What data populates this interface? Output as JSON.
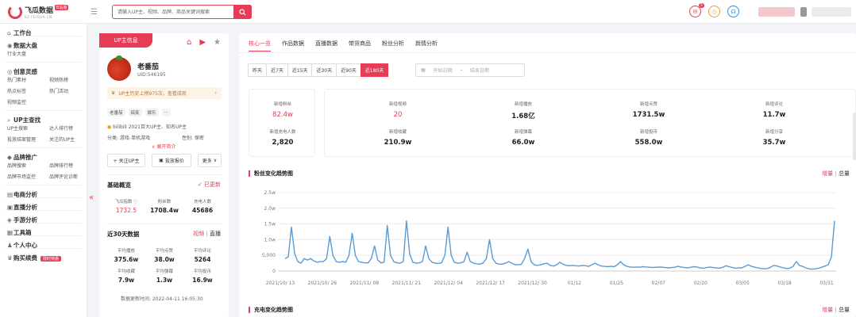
{
  "header": {
    "logo_name": "飞瓜数据",
    "logo_badge": "B站版",
    "logo_sub": "BZ.FEIGUA.CN",
    "search_placeholder": "请输入UP主、视频、品牌、商品关键词搜索",
    "message_count": "5",
    "icons": [
      "search-icon",
      "message-icon",
      "clock-icon",
      "headset-icon",
      "menu-icon"
    ]
  },
  "sidebar": {
    "groups": [
      {
        "icon": "home-icon",
        "title": "工作台",
        "items": []
      },
      {
        "icon": "chart-icon",
        "title": "数据大盘",
        "items": [
          "行业大盘"
        ]
      },
      {
        "icon": "bulb-icon",
        "title": "创意灵感",
        "items": [
          "热门素材",
          "视频热榜",
          "热点标签",
          "热门活动",
          "视频监控"
        ]
      },
      {
        "icon": "search-icon",
        "title": "UP主查找",
        "items": [
          "UP主搜索",
          "达人排行榜",
          "投放结案管理",
          "关注的UP主"
        ]
      },
      {
        "icon": "diamond-icon",
        "title": "品牌推广",
        "items": [
          "品牌搜索",
          "品牌排行榜",
          "品牌市场监控",
          "品牌评论诊断"
        ]
      },
      {
        "icon": "cart-icon",
        "title": "电商分析",
        "items": []
      },
      {
        "icon": "live-icon",
        "title": "直播分析",
        "items": []
      },
      {
        "icon": "game-icon",
        "title": "手游分析",
        "items": []
      },
      {
        "icon": "tools-icon",
        "title": "工具箱",
        "items": []
      },
      {
        "icon": "user-icon",
        "title": "个人中心",
        "items": []
      },
      {
        "icon": "vip-icon",
        "title": "购买续费",
        "items": [],
        "promo": "限时特惠"
      }
    ]
  },
  "profile": {
    "tab_label": "UP主信息",
    "name": "老番茄",
    "uid": "UID:546195",
    "honor": "UP主历史上榜975次，查看成就",
    "tags": [
      "老番茄",
      "搞笑",
      "娱乐",
      "..."
    ],
    "award": "bilibili 2021百大UP主、知名UP主",
    "category": "分类: 游戏-单机游戏",
    "gender": "性别: 保密",
    "expand_label": "展开简介",
    "buttons": {
      "follow": "+ 关注UP主",
      "quote": "投放报价",
      "more": "更多"
    },
    "basic": {
      "title": "基础概览",
      "update_label": "已更新",
      "metrics": [
        {
          "label": "飞瓜指数",
          "value": "1732.5"
        },
        {
          "label": "粉丝数",
          "value": "1708.4w"
        },
        {
          "label": "充电人数",
          "value": "45686"
        }
      ]
    },
    "recent": {
      "title": "近30天数据",
      "toggle_a": "视频",
      "toggle_sep": "|",
      "toggle_b": "直播",
      "metrics": [
        {
          "label": "平均播放",
          "value": "375.6w"
        },
        {
          "label": "平均点赞",
          "value": "38.0w"
        },
        {
          "label": "平均评论",
          "value": "5264"
        },
        {
          "label": "平均收藏",
          "value": "7.9w"
        },
        {
          "label": "平均弹幕",
          "value": "1.3w"
        },
        {
          "label": "平均投币",
          "value": "16.9w"
        }
      ],
      "updated": "数据更新时间:  2022-04-11 16:05:30"
    }
  },
  "main": {
    "tabs": [
      "核心一览",
      "作品数据",
      "直播数据",
      "带货商品",
      "粉丝分析",
      "舆情分析"
    ],
    "active_tab": 0,
    "ranges": [
      "昨天",
      "近7天",
      "近15天",
      "近30天",
      "近90天",
      "近180天"
    ],
    "active_range": 5,
    "date_start": "开始日期",
    "date_sep": "-",
    "date_end": "结束日期",
    "kpi_left": [
      {
        "label": "新增粉丝",
        "value": "82.4w",
        "accent": true
      },
      {
        "label": "新增充电人数",
        "value": "2,820"
      }
    ],
    "kpi_right": [
      {
        "label": "新增视频",
        "value": "20",
        "accent": true
      },
      {
        "label": "新增播放",
        "value": "1.68亿"
      },
      {
        "label": "新增点赞",
        "value": "1731.5w"
      },
      {
        "label": "新增评论",
        "value": "11.7w"
      },
      {
        "label": "新增收藏",
        "value": "210.9w"
      },
      {
        "label": "新增弹幕",
        "value": "66.0w"
      },
      {
        "label": "新增投币",
        "value": "558.0w"
      },
      {
        "label": "新增分享",
        "value": "35.7w"
      }
    ],
    "chart1_title": "粉丝变化趋势图",
    "chart2_title": "充电变化趋势图",
    "toggle_inc": "增量",
    "toggle_sep": "|",
    "toggle_total": "总量"
  },
  "chart_data": {
    "type": "line",
    "title": "粉丝变化趋势图",
    "yticks": [
      "0",
      "5,000",
      "1.0w",
      "1.5w",
      "2.0w",
      "2.5w"
    ],
    "ylim": [
      0,
      25000
    ],
    "xticks": [
      "2021/10/ 13",
      "2021/10/ 26",
      "2021/11/ 08",
      "2021/11/ 21",
      "2021/12/ 04",
      "2021/12/ 17",
      "2021/12/ 30",
      "01/12",
      "01/25",
      "02/07",
      "02/20",
      "03/05",
      "03/18",
      "03/31"
    ],
    "color": "#5b9bd5",
    "grid": true,
    "series": [
      {
        "values": [
          4000,
          4500,
          14000,
          5500,
          3000,
          2500,
          4000,
          3500,
          4000,
          3200,
          2800,
          3000,
          3000,
          4000,
          11000,
          5000,
          3000,
          2800,
          3000,
          2800,
          5000,
          12000,
          5000,
          3000,
          2800,
          2600,
          2600,
          4000,
          8000,
          3500,
          2600,
          2800,
          14500,
          5000,
          3000,
          2600,
          2500,
          3000,
          16000,
          5500,
          2800,
          2500,
          2600,
          3000,
          8000,
          4000,
          2800,
          2500,
          2400,
          2600,
          5000,
          14000,
          5000,
          2800,
          2500,
          2600,
          3000,
          6000,
          3000,
          2500,
          2300,
          2200,
          2500,
          4000,
          10000,
          4000,
          2500,
          2200,
          2200,
          2500,
          3000,
          2500,
          2000,
          2000,
          2200,
          4000,
          7000,
          3000,
          2000,
          1800,
          2000,
          2300,
          2500,
          1800,
          1600,
          2000,
          2800,
          2200,
          1800,
          1700,
          1800,
          1700,
          1600,
          1800,
          1700,
          1500,
          2000,
          2500,
          2000,
          1600,
          1500,
          1400,
          1500,
          1400,
          2000,
          3000,
          2000,
          1500,
          1300,
          1200,
          1300,
          1200,
          1400,
          1300,
          1200,
          1100,
          1200,
          1300,
          1200,
          1100,
          1000,
          1100,
          1200,
          1500,
          1300,
          1100,
          1000,
          1200,
          1400,
          1300,
          1000,
          900,
          1100,
          1300,
          1100,
          1000,
          900,
          1200,
          1700,
          1400,
          1100,
          900,
          1000,
          1000,
          1500,
          2000,
          1500,
          1200,
          1000,
          800,
          700,
          800,
          1200,
          1800,
          1600,
          1300,
          1000,
          800,
          900,
          1500,
          3000,
          1800,
          1500,
          1000,
          700,
          600,
          700,
          900,
          1200,
          1600,
          2000,
          4500,
          16000
        ]
      }
    ]
  }
}
